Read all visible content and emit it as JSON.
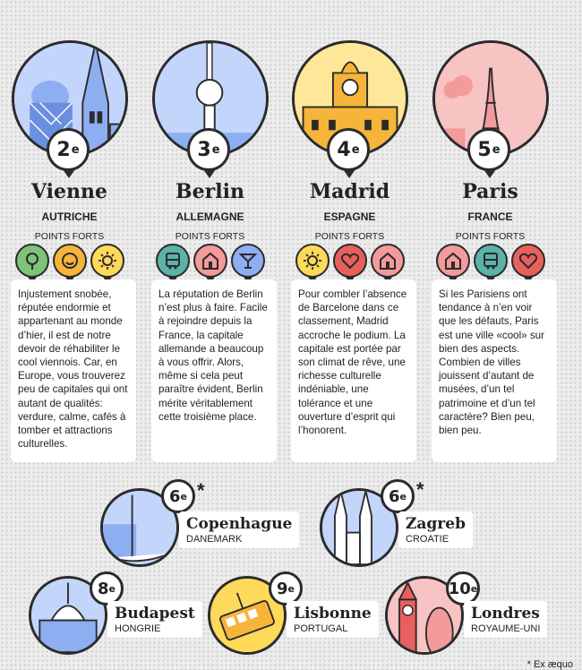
{
  "colors": {
    "blue": "#8eaef2",
    "lightblue": "#c3d5fb",
    "yellow": "#ffd95a",
    "orange": "#f6b53a",
    "pink": "#f39a9a",
    "lightpink": "#f8c3c3",
    "green": "#7fc37a",
    "teal": "#5ab3a8",
    "red": "#e8605d",
    "dark": "#2b2b2b"
  },
  "points_label": "POINTS FORTS",
  "top": [
    {
      "rank": "2",
      "rank_sup": "e",
      "city": "Vienne",
      "country": "AUTRICHE",
      "icons": [
        "tree-icon",
        "smiley-icon",
        "sun-icon"
      ],
      "text": "Injustement snobée, réputée endormie et appartenant au monde d’hier, il est de notre devoir de réhabiliter le cool viennois. Car, en Europe, vous trouverez peu de capitales qui ont autant de qualités: verdure, calme, cafés à tomber et attractions culturelles."
    },
    {
      "rank": "3",
      "rank_sup": "e",
      "city": "Berlin",
      "country": "ALLEMAGNE",
      "icons": [
        "bus-icon",
        "building-icon",
        "cocktail-icon"
      ],
      "text": "La réputation de Berlin n’est plus à faire. Facile à rejoindre depuis la France, la capitale allemande a beaucoup à vous offrir. Alors, même si cela peut paraître évident, Berlin mérite véritablement cette troisième place."
    },
    {
      "rank": "4",
      "rank_sup": "e",
      "city": "Madrid",
      "country": "ESPAGNE",
      "icons": [
        "sun-icon",
        "heart-icon",
        "building-icon"
      ],
      "text": "Pour combler l’absence de Barcelone dans ce classement, Madrid accroche le podium. La capitale est portée par son climat de rêve, une richesse culturelle indéniable, une tolérance et une ouverture d’esprit qui l’honorent."
    },
    {
      "rank": "5",
      "rank_sup": "e",
      "city": "Paris",
      "country": "FRANCE",
      "icons": [
        "building-icon",
        "bus-icon",
        "heart-icon"
      ],
      "text": "Si les Parisiens ont tendance à n’en voir que les défauts, Paris est une ville «cool» sur bien des aspects. Combien de villes jouissent d’autant de musées, d’un tel patrimoine et d’un tel caractère? Bien peu, bien peu."
    }
  ],
  "bottom": [
    {
      "rank": "6",
      "rank_sup": "e",
      "star": "*",
      "city": "Copenhague",
      "country": "DANEMARK"
    },
    {
      "rank": "6",
      "rank_sup": "e",
      "star": "*",
      "city": "Zagreb",
      "country": "CROATIE"
    },
    {
      "rank": "8",
      "rank_sup": "e",
      "city": "Budapest",
      "country": "HONGRIE"
    },
    {
      "rank": "9",
      "rank_sup": "e",
      "city": "Lisbonne",
      "country": "PORTUGAL"
    },
    {
      "rank": "10",
      "rank_sup": "e",
      "city": "Londres",
      "country": "ROYAUME-UNI"
    }
  ],
  "footnote": "* Ex æquo"
}
